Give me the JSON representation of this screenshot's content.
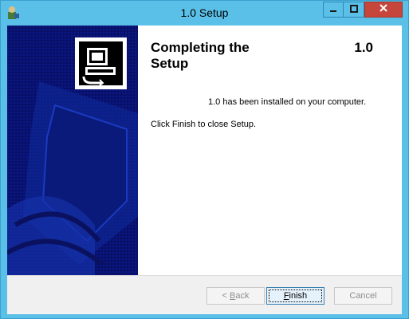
{
  "window": {
    "title": "1.0 Setup",
    "accent_color": "#5bc0e8",
    "close_color": "#c7463c",
    "app_icon": "installer-icon"
  },
  "banner": {
    "background_color": "#09106a",
    "logo_icon": "setup-computer-icon"
  },
  "content": {
    "heading": "Completing the Setup",
    "version": "1.0",
    "installed_message": "1.0 has been installed on your computer.",
    "close_message": "Click Finish to close Setup."
  },
  "buttons": {
    "back": {
      "label_prefix": "< ",
      "label_accel": "B",
      "label_rest": "ack",
      "enabled": false
    },
    "finish": {
      "label_accel": "F",
      "label_rest": "inish",
      "enabled": true,
      "focused": true
    },
    "cancel": {
      "label": "Cancel",
      "enabled": false
    }
  }
}
